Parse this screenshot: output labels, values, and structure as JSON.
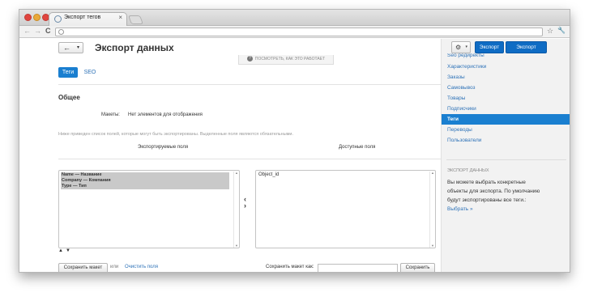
{
  "browser": {
    "tab_title": "Экспорт тегов",
    "tab_close": "×",
    "nav_back": "←",
    "nav_forward": "→",
    "nav_reload": "C",
    "url": "",
    "star": "☆",
    "wrench": "🔧"
  },
  "header": {
    "back_label": "←",
    "back_caret": "▾",
    "page_title": "Экспорт данных",
    "how_it_works": "ПОСМОТРЕТЬ, КАК ЭТО РАБОТАЕТ",
    "how_icon": "?"
  },
  "tabs": [
    {
      "label": "Теги",
      "active": true
    },
    {
      "label": "SEO",
      "active": false
    }
  ],
  "general": {
    "section_title": "Общее",
    "layouts_label": "Макеты:",
    "layouts_value": "Нет элементов для отображения",
    "hint": "Ниже приведен список полей, которые могут быть экспортированы. Выделенные поля являются обязательными.",
    "exported_label": "Экспортируемые поля",
    "available_label": "Доступные поля"
  },
  "exported_fields": [
    "Name — Название",
    "Company — Компания",
    "Type — Тип"
  ],
  "available_fields": [
    "Object_id"
  ],
  "controls": {
    "move_left": "‹",
    "move_right": "›",
    "order_up": "▲",
    "order_down": "▼",
    "save_layout": "Сохранить макет",
    "or_text": "или",
    "clear_fields": "Очистить поля",
    "save_layout_as_label": "Сохранить макет как:",
    "save_layout_as_value": "",
    "save": "Сохранить"
  },
  "top_actions": {
    "gear": "⚙",
    "gear_caret": "▾",
    "export_1": "Экспорт",
    "export_2": "Экспорт"
  },
  "sidebar": {
    "items": [
      {
        "label": "Seo редиректы",
        "active": false
      },
      {
        "label": "Характеристики",
        "active": false
      },
      {
        "label": "Заказы",
        "active": false
      },
      {
        "label": "Самовывоз",
        "active": false
      },
      {
        "label": "Товары",
        "active": false
      },
      {
        "label": "Подписчики",
        "active": false
      },
      {
        "label": "Теги",
        "active": true
      },
      {
        "label": "Переводы",
        "active": false
      },
      {
        "label": "Пользователи",
        "active": false
      }
    ],
    "info_heading": "ЭКСПОРТ ДАННЫХ",
    "info_text": "Вы можете выбрать конкретные объекты для экспорта. По умолчанию будут экспортированы все теги.:",
    "info_link": "Выбрать »"
  },
  "colors": {
    "accent": "#1a7fd0",
    "button_blue": "#0f6cc4",
    "link": "#2f73b8"
  }
}
